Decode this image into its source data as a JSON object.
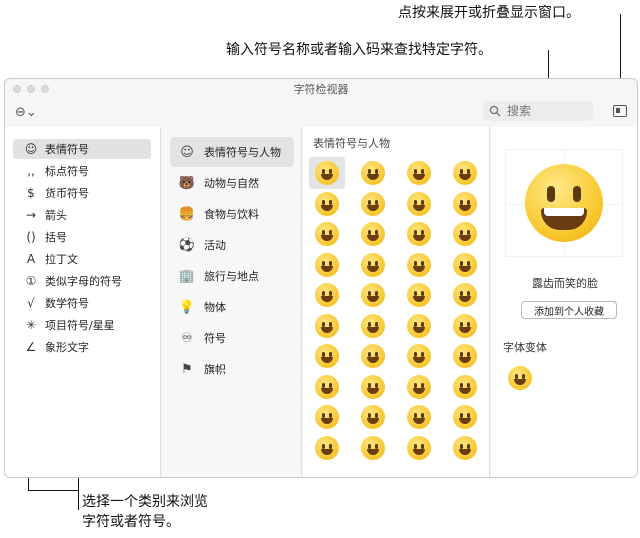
{
  "callouts": {
    "expand": "点按来展开或折叠显示窗口。",
    "search": "输入符号名称或者输入码来查找特定字符。",
    "category_line1": "选择一个类别来浏览",
    "category_line2": "字符或者符号。"
  },
  "window": {
    "title": "字符检视器"
  },
  "toolbar": {
    "options_icon": "options-icon",
    "search_placeholder": "搜索",
    "expand_icon": "expand-collapse-icon"
  },
  "left_list": [
    {
      "icon": "☺",
      "label": "表情符号"
    },
    {
      "icon": "‚‚",
      "label": "标点符号"
    },
    {
      "icon": "$",
      "label": "货币符号"
    },
    {
      "icon": "→",
      "label": "箭头"
    },
    {
      "icon": "()",
      "label": "括号"
    },
    {
      "icon": "A",
      "label": "拉丁文"
    },
    {
      "icon": "①",
      "label": "类似字母的符号"
    },
    {
      "icon": "√",
      "label": "数学符号"
    },
    {
      "icon": "✳",
      "label": "项目符号/星星"
    },
    {
      "icon": "∠",
      "label": "象形文字"
    }
  ],
  "categories": [
    {
      "icon": "☺",
      "label": "表情符号与人物"
    },
    {
      "icon": "🐻",
      "label": "动物与自然"
    },
    {
      "icon": "🍔",
      "label": "食物与饮料"
    },
    {
      "icon": "⚽",
      "label": "活动"
    },
    {
      "icon": "🏢",
      "label": "旅行与地点"
    },
    {
      "icon": "💡",
      "label": "物体"
    },
    {
      "icon": "♾",
      "label": "符号"
    },
    {
      "icon": "⚑",
      "label": "旗帜"
    }
  ],
  "grid": {
    "title": "表情符号与人物",
    "rows": 10,
    "cols": 4
  },
  "detail": {
    "emoji_name": "露齿而笑的脸",
    "favorite_button": "添加到个人收藏",
    "variants_label": "字体变体"
  }
}
